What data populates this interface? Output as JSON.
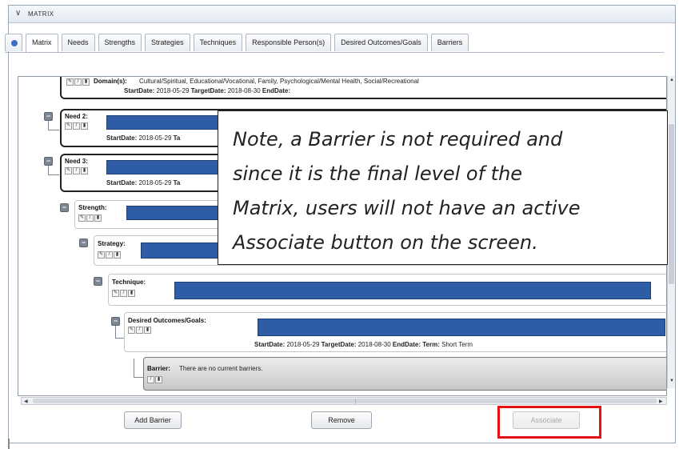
{
  "header": {
    "chevron_icon": "chevron-down-icon",
    "title": "MATRIX"
  },
  "tabs": [
    {
      "label": "",
      "icon": "globe-icon"
    },
    {
      "label": "Matrix"
    },
    {
      "label": "Needs"
    },
    {
      "label": "Strengths"
    },
    {
      "label": "Strategies"
    },
    {
      "label": "Techniques"
    },
    {
      "label": "Responsible Person(s)"
    },
    {
      "label": "Desired Outcomes/Goals"
    },
    {
      "label": "Barriers"
    }
  ],
  "tree": {
    "domain": {
      "label": "Domain(s):",
      "value": "Cultural/Spiritual, Educational/Vocational, Family, Psychological/Mental Health, Social/Recreational",
      "start_label": "StartDate:",
      "start": "2018-05-29",
      "target_label": "TargetDate:",
      "target": "2018-08-30",
      "end_label": "EndDate:"
    },
    "need2": {
      "label": "Need 2:",
      "start_label": "StartDate:",
      "start": "2018-05-29",
      "target_fragment": "Ta"
    },
    "need3": {
      "label": "Need 3:",
      "start_label": "StartDate:",
      "start": "2018-05-29",
      "target_fragment": "Ta"
    },
    "strength": {
      "label": "Strength:"
    },
    "strategy": {
      "label": "Strategy:"
    },
    "technique": {
      "label": "Technique:"
    },
    "outcome": {
      "label": "Desired Outcomes/Goals:",
      "start_label": "StartDate:",
      "start": "2018-05-29",
      "target_label": "TargetDate:",
      "target": "2018-08-30",
      "end_label": "EndDate:",
      "term_label": "Term:",
      "term": "Short Term"
    },
    "barrier": {
      "label": "Barrier:",
      "value": "There are no current barriers."
    }
  },
  "note": {
    "lines": [
      "Note, a Barrier is not required and",
      "since it is the final level of the",
      "Matrix, users will not have an active",
      "Associate button on the screen."
    ]
  },
  "buttons": {
    "add_barrier": "Add Barrier",
    "remove": "Remove",
    "associate": "Associate"
  },
  "colors": {
    "redaction": "#2e5da6",
    "highlight": "#e31212",
    "collapse": "#7d8693"
  }
}
